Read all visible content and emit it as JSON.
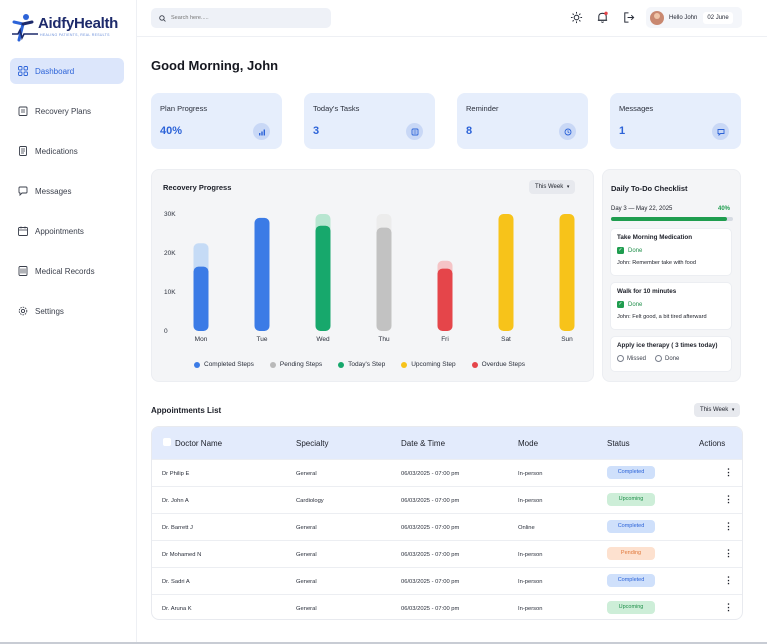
{
  "brand": {
    "name": "AidfyHealth",
    "tagline": "HEALING PATIENTS, REAL RESULTS"
  },
  "sidebar": {
    "items": [
      {
        "label": "Dashboard",
        "icon": "grid-icon",
        "active": true
      },
      {
        "label": "Recovery Plans",
        "icon": "clipboard-icon",
        "active": false
      },
      {
        "label": "Medications",
        "icon": "pill-list-icon",
        "active": false
      },
      {
        "label": "Messages",
        "icon": "chat-icon",
        "active": false
      },
      {
        "label": "Appointments",
        "icon": "calendar-icon",
        "active": false
      },
      {
        "label": "Medical Records",
        "icon": "records-icon",
        "active": false
      },
      {
        "label": "Settings",
        "icon": "gear-icon",
        "active": false
      }
    ]
  },
  "topbar": {
    "search_placeholder": "Search here.....",
    "user_greeting": "Hello John",
    "date": "02 June"
  },
  "greeting": "Good Morning, John",
  "cards": [
    {
      "label": "Plan Progress",
      "value": "40%",
      "icon": "chart-icon"
    },
    {
      "label": "Today's Tasks",
      "value": "3",
      "icon": "tasks-icon"
    },
    {
      "label": "Reminder",
      "value": "8",
      "icon": "clock-icon"
    },
    {
      "label": "Messages",
      "value": "1",
      "icon": "message-icon"
    }
  ],
  "recovery": {
    "title": "Recovery Progress",
    "filter": "This Week"
  },
  "chart_data": {
    "type": "bar",
    "title": "Recovery Progress",
    "categories": [
      "Mon",
      "Tue",
      "Wed",
      "Thu",
      "Fri",
      "Sat",
      "Sun"
    ],
    "y_ticks": [
      "30K",
      "20K",
      "10K",
      "0"
    ],
    "ylim": [
      0,
      30000
    ],
    "grid": false,
    "legend_position": "bottom",
    "bars": [
      {
        "day": "Mon",
        "status": "completed",
        "value": 16500,
        "total": 22500
      },
      {
        "day": "Tue",
        "status": "completed",
        "value": 29000,
        "total": 29000
      },
      {
        "day": "Wed",
        "status": "todays",
        "value": 27000,
        "total": 30000
      },
      {
        "day": "Thu",
        "status": "pending",
        "value": 26500,
        "total": 30000
      },
      {
        "day": "Fri",
        "status": "overdue",
        "value": 16000,
        "total": 18000
      },
      {
        "day": "Sat",
        "status": "upcoming",
        "value": 30000,
        "total": 30000
      },
      {
        "day": "Sun",
        "status": "upcoming",
        "value": 30000,
        "total": 30000
      }
    ],
    "legend": [
      {
        "name": "Completed Steps",
        "color": "#3b7be6"
      },
      {
        "name": "Pending Steps",
        "color": "#b9b9b9"
      },
      {
        "name": "Today's Step",
        "color": "#17a86c"
      },
      {
        "name": "Upcoming Step",
        "color": "#f7c31a"
      },
      {
        "name": "Overdue Steps",
        "color": "#e5454a"
      }
    ],
    "colors": {
      "completed": "#3b7be6",
      "completed_light": "#c5dbf6",
      "todays": "#17a86c",
      "todays_light": "#b8e6d1",
      "pending": "#c2c2c2",
      "pending_light": "#ececec",
      "overdue": "#e5454a",
      "overdue_light": "#f5c4c6",
      "upcoming": "#f7c31a"
    }
  },
  "checklist": {
    "title": "Daily To-Do Checklist",
    "day_label": "Day 3 — May 22, 2025",
    "progress_label": "40%",
    "progress": 0.95,
    "items": [
      {
        "title": "Take Morning Medication",
        "status": "Done",
        "note": "John: Remember take with food"
      },
      {
        "title": "Walk for 10 minutes",
        "status": "Done",
        "note": "John: Felt good, a bit tired afterward"
      }
    ],
    "pending_item": {
      "title": "Apply ice therapy ( 3 times today)",
      "option_missed": "Missed",
      "option_done": "Done"
    }
  },
  "appointments": {
    "title": "Appointments List",
    "filter": "This Week",
    "headers": {
      "doctor": "Doctor Name",
      "specialty": "Specialty",
      "datetime": "Date & Time",
      "mode": "Mode",
      "status": "Status",
      "actions": "Actions"
    },
    "rows": [
      {
        "doctor": "Dr Philip E",
        "specialty": "General",
        "datetime": "06/03/2025 - 07:00 pm",
        "mode": "In-person",
        "status": "Completed"
      },
      {
        "doctor": "Dr. John A",
        "specialty": "Cardiology",
        "datetime": "06/03/2025 - 07:00 pm",
        "mode": "In-person",
        "status": "Upcoming"
      },
      {
        "doctor": "Dr. Barrett J",
        "specialty": "General",
        "datetime": "06/03/2025 - 07:00 pm",
        "mode": "Online",
        "status": "Completed"
      },
      {
        "doctor": "Dr Mohamed N",
        "specialty": "General",
        "datetime": "06/03/2025 - 07:00 pm",
        "mode": "In-person",
        "status": "Pending"
      },
      {
        "doctor": "Dr. Sadri A",
        "specialty": "General",
        "datetime": "06/03/2025 - 07:00 pm",
        "mode": "In-person",
        "status": "Completed"
      },
      {
        "doctor": "Dr. Aruna K",
        "specialty": "General",
        "datetime": "06/03/2025 - 07:00 pm",
        "mode": "In-person",
        "status": "Upcoming"
      }
    ],
    "status_colors": {
      "Completed": {
        "bg": "#cfe0fb",
        "fg": "#2c63d8"
      },
      "Upcoming": {
        "bg": "#cdeed8",
        "fg": "#1f8f4a"
      },
      "Pending": {
        "bg": "#fde1cf",
        "fg": "#e0783a"
      }
    }
  }
}
